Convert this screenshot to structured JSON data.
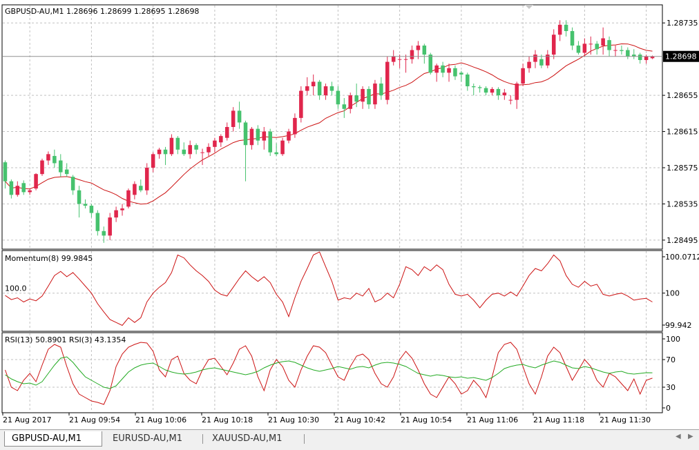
{
  "window": {
    "main_title": "GBPUSD-AU,M1  1.28696 1.28699 1.28695 1.28698",
    "current_price": "1.28698"
  },
  "panels": {
    "price": {
      "axis_labels": [
        "1.28735",
        "1.28655",
        "1.28615",
        "1.28575",
        "1.28535",
        "1.28495"
      ]
    },
    "momentum": {
      "title": "Momentum(8) 99.9845",
      "level_label": "100.0",
      "axis_labels": [
        "100.0712",
        "100",
        "99.942"
      ]
    },
    "rsi": {
      "title": "RSI(13) 50.8901  RSI(3) 43.1354",
      "axis_labels": [
        "100",
        "70",
        "30",
        "0"
      ]
    }
  },
  "time_axis": [
    "21 Aug 2017",
    "21 Aug 09:54",
    "21 Aug 10:06",
    "21 Aug 10:18",
    "21 Aug 10:30",
    "21 Aug 10:42",
    "21 Aug 10:54",
    "21 Aug 11:06",
    "21 Aug 11:18",
    "21 Aug 11:30"
  ],
  "colors": {
    "bull": "#e0264c",
    "bear": "#46c26e",
    "ma": "#cc1111",
    "momentum": "#cc1111",
    "rsi_fast": "#cc1111",
    "rsi_slow": "#22aa22",
    "grid": "#c0c0c0"
  },
  "tabs": [
    {
      "label": "GBPUSD-AU,M1",
      "active": true
    },
    {
      "label": "EURUSD-AU,M1",
      "active": false
    },
    {
      "label": "XAUUSD-AU,M1",
      "active": false
    }
  ],
  "chart_data": {
    "type": "candlestick",
    "symbol": "GBPUSD-AU,M1",
    "ylim": [
      1.28485,
      1.28755
    ],
    "ohlc": [
      [
        1.28581,
        1.28583,
        1.28552,
        1.2856
      ],
      [
        1.2856,
        1.28562,
        1.28541,
        1.28545
      ],
      [
        1.28545,
        1.2856,
        1.28543,
        1.28555
      ],
      [
        1.28558,
        1.28561,
        1.28545,
        1.28548
      ],
      [
        1.28548,
        1.28552,
        1.28545,
        1.2855
      ],
      [
        1.28552,
        1.28569,
        1.2855,
        1.28568
      ],
      [
        1.28568,
        1.28585,
        1.28566,
        1.28583
      ],
      [
        1.28583,
        1.28593,
        1.28578,
        1.2859
      ],
      [
        1.28588,
        1.28595,
        1.28575,
        1.2858
      ],
      [
        1.28583,
        1.2859,
        1.28565,
        1.2857
      ],
      [
        1.28573,
        1.2858,
        1.28565,
        1.28568
      ],
      [
        1.28565,
        1.28567,
        1.28545,
        1.2855
      ],
      [
        1.2855,
        1.28555,
        1.2852,
        1.28535
      ],
      [
        1.28535,
        1.2854,
        1.2853,
        1.28533
      ],
      [
        1.28533,
        1.28535,
        1.2852,
        1.28525
      ],
      [
        1.28525,
        1.28528,
        1.285,
        1.28505
      ],
      [
        1.28505,
        1.2851,
        1.28492,
        1.285
      ],
      [
        1.285,
        1.28525,
        1.28495,
        1.2852
      ],
      [
        1.2852,
        1.28532,
        1.28515,
        1.28528
      ],
      [
        1.28528,
        1.28535,
        1.28522,
        1.2853
      ],
      [
        1.28532,
        1.28552,
        1.2853,
        1.2855
      ],
      [
        1.28545,
        1.2856,
        1.2854,
        1.28557
      ],
      [
        1.28555,
        1.28562,
        1.28548,
        1.2855
      ],
      [
        1.2855,
        1.2858,
        1.28545,
        1.28575
      ],
      [
        1.28575,
        1.28592,
        1.2857,
        1.2859
      ],
      [
        1.2859,
        1.28597,
        1.28585,
        1.28595
      ],
      [
        1.28595,
        1.28598,
        1.28578,
        1.2859
      ],
      [
        1.2859,
        1.28612,
        1.28588,
        1.28608
      ],
      [
        1.28608,
        1.2861,
        1.2859,
        1.28595
      ],
      [
        1.28595,
        1.28603,
        1.28588,
        1.2859
      ],
      [
        1.2859,
        1.28605,
        1.28585,
        1.286
      ],
      [
        1.286,
        1.28602,
        1.2859,
        1.28595
      ],
      [
        1.28592,
        1.28596,
        1.28578,
        1.28592
      ],
      [
        1.28592,
        1.28602,
        1.28588,
        1.28598
      ],
      [
        1.28598,
        1.28608,
        1.28592,
        1.28605
      ],
      [
        1.28603,
        1.28612,
        1.28598,
        1.2861
      ],
      [
        1.28608,
        1.28625,
        1.28605,
        1.2862
      ],
      [
        1.2862,
        1.28642,
        1.28615,
        1.28638
      ],
      [
        1.28638,
        1.28648,
        1.28618,
        1.28625
      ],
      [
        1.28625,
        1.28627,
        1.2856,
        1.286
      ],
      [
        1.286,
        1.2862,
        1.28595,
        1.28618
      ],
      [
        1.28618,
        1.28622,
        1.286,
        1.28605
      ],
      [
        1.28605,
        1.2862,
        1.28595,
        1.28615
      ],
      [
        1.28615,
        1.28618,
        1.28588,
        1.28592
      ],
      [
        1.28592,
        1.28602,
        1.28588,
        1.2859
      ],
      [
        1.2859,
        1.28608,
        1.28588,
        1.28605
      ],
      [
        1.28605,
        1.28618,
        1.28602,
        1.28615
      ],
      [
        1.28612,
        1.28635,
        1.28608,
        1.2863
      ],
      [
        1.2863,
        1.28665,
        1.28625,
        1.2866
      ],
      [
        1.2866,
        1.28675,
        1.28655,
        1.28665
      ],
      [
        1.28665,
        1.28678,
        1.28655,
        1.2867
      ],
      [
        1.2867,
        1.28672,
        1.2865,
        1.28655
      ],
      [
        1.28655,
        1.28668,
        1.2865,
        1.28665
      ],
      [
        1.28665,
        1.2867,
        1.28655,
        1.2866
      ],
      [
        1.2866,
        1.28665,
        1.2864,
        1.28645
      ],
      [
        1.28645,
        1.28652,
        1.2863,
        1.2864
      ],
      [
        1.2864,
        1.28658,
        1.28635,
        1.28655
      ],
      [
        1.28655,
        1.28668,
        1.28642,
        1.28648
      ],
      [
        1.28648,
        1.28665,
        1.2864,
        1.28662
      ],
      [
        1.28662,
        1.28665,
        1.2864,
        1.28645
      ],
      [
        1.28645,
        1.28672,
        1.2864,
        1.28668
      ],
      [
        1.28668,
        1.28675,
        1.2865,
        1.28655
      ],
      [
        1.2865,
        1.28698,
        1.28645,
        1.28692
      ],
      [
        1.28692,
        1.28705,
        1.28688,
        1.28698
      ],
      [
        1.28695,
        1.287,
        1.28685,
        1.28695
      ],
      [
        1.28695,
        1.287,
        1.2868,
        1.28695
      ],
      [
        1.28695,
        1.2871,
        1.2869,
        1.28705
      ],
      [
        1.28705,
        1.28715,
        1.28695,
        1.2871
      ],
      [
        1.2871,
        1.28712,
        1.2869,
        1.287
      ],
      [
        1.287,
        1.28702,
        1.28678,
        1.2868
      ],
      [
        1.2868,
        1.2869,
        1.2867,
        1.28688
      ],
      [
        1.28688,
        1.28692,
        1.28675,
        1.2868
      ],
      [
        1.2868,
        1.2869,
        1.2867,
        1.28685
      ],
      [
        1.28685,
        1.28688,
        1.28672,
        1.28676
      ],
      [
        1.2868,
        1.28682,
        1.2867,
        1.28678
      ],
      [
        1.28678,
        1.2868,
        1.2866,
        1.28665
      ],
      [
        1.28665,
        1.28668,
        1.28655,
        1.28664
      ],
      [
        1.28664,
        1.28666,
        1.28658,
        1.28663
      ],
      [
        1.28663,
        1.28665,
        1.28655,
        1.28658
      ],
      [
        1.28658,
        1.28664,
        1.28655,
        1.28662
      ],
      [
        1.28662,
        1.28664,
        1.2865,
        1.28655
      ],
      [
        1.28655,
        1.28662,
        1.2865,
        1.28658
      ],
      [
        1.2865,
        1.28655,
        1.28645,
        1.2865
      ],
      [
        1.2865,
        1.2867,
        1.2864,
        1.28668
      ],
      [
        1.28668,
        1.2869,
        1.28665,
        1.28685
      ],
      [
        1.28685,
        1.28698,
        1.2868,
        1.28692
      ],
      [
        1.28692,
        1.28705,
        1.28685,
        1.287
      ],
      [
        1.28695,
        1.287,
        1.28685,
        1.28688
      ],
      [
        1.28688,
        1.28705,
        1.28685,
        1.287
      ],
      [
        1.287,
        1.28728,
        1.28695,
        1.28722
      ],
      [
        1.28722,
        1.28738,
        1.28715,
        1.28733
      ],
      [
        1.28733,
        1.28738,
        1.2872,
        1.28726
      ],
      [
        1.28726,
        1.2873,
        1.28705,
        1.2871
      ],
      [
        1.2871,
        1.28715,
        1.287,
        1.28702
      ],
      [
        1.28702,
        1.28718,
        1.28698,
        1.28712
      ],
      [
        1.28712,
        1.2872,
        1.287,
        1.28712
      ],
      [
        1.28712,
        1.28715,
        1.287,
        1.28706
      ],
      [
        1.2871,
        1.2873,
        1.287,
        1.28718
      ],
      [
        1.28716,
        1.2872,
        1.28698,
        1.28705
      ],
      [
        1.28705,
        1.2871,
        1.28698,
        1.28705
      ],
      [
        1.28705,
        1.2871,
        1.287,
        1.28704
      ],
      [
        1.28705,
        1.28708,
        1.28695,
        1.28698
      ],
      [
        1.287,
        1.28706,
        1.28695,
        1.28698
      ],
      [
        1.287,
        1.28702,
        1.2869,
        1.28694
      ],
      [
        1.28694,
        1.287,
        1.2869,
        1.28698
      ],
      [
        1.28696,
        1.28699,
        1.28695,
        1.28698
      ]
    ],
    "ma_period": 13,
    "momentum": {
      "ylim": [
        99.935,
        100.0725
      ],
      "level": 100.0,
      "values": [
        99.996,
        99.989,
        99.992,
        99.985,
        99.99,
        99.987,
        99.995,
        100.012,
        100.03,
        100.037,
        100.028,
        100.035,
        100.024,
        100.012,
        100.0,
        99.982,
        99.968,
        99.955,
        99.95,
        99.945,
        99.958,
        99.95,
        99.958,
        99.985,
        100.0,
        100.01,
        100.018,
        100.035,
        100.065,
        100.06,
        100.048,
        100.038,
        100.03,
        100.02,
        100.005,
        99.998,
        99.995,
        100.01,
        100.025,
        100.038,
        100.028,
        100.02,
        100.028,
        100.018,
        99.998,
        99.985,
        99.96,
        99.992,
        100.02,
        100.042,
        100.065,
        100.07,
        100.045,
        100.02,
        99.988,
        99.992,
        99.99,
        100.0,
        99.995,
        100.008,
        99.985,
        99.99,
        100.0,
        99.992,
        100.015,
        100.045,
        100.04,
        100.03,
        100.045,
        100.038,
        100.048,
        100.04,
        100.015,
        99.998,
        99.995,
        99.998,
        99.988,
        99.975,
        99.988,
        99.998,
        100.0,
        99.995,
        100.002,
        99.995,
        100.012,
        100.03,
        100.042,
        100.038,
        100.05,
        100.065,
        100.055,
        100.03,
        100.015,
        100.01,
        100.02,
        100.012,
        100.015,
        99.998,
        99.995,
        99.998,
        100.0,
        99.995,
        99.988,
        99.99,
        99.991,
        99.985
      ]
    },
    "rsi": {
      "ylim": [
        0,
        100
      ],
      "rsi13": [
        48,
        42,
        38,
        35,
        36,
        33,
        38,
        50,
        62,
        72,
        74,
        66,
        55,
        45,
        40,
        35,
        30,
        28,
        32,
        42,
        52,
        58,
        62,
        64,
        65,
        60,
        55,
        52,
        50,
        49,
        50,
        52,
        55,
        57,
        58,
        56,
        54,
        52,
        50,
        48,
        50,
        53,
        58,
        62,
        65,
        67,
        68,
        66,
        62,
        58,
        55,
        53,
        55,
        57,
        60,
        58,
        56,
        59,
        60,
        58,
        62,
        65,
        66,
        65,
        63,
        60,
        55,
        50,
        48,
        46,
        48,
        47,
        45,
        44,
        45,
        43,
        44,
        42,
        40,
        44,
        50,
        57,
        60,
        62,
        63,
        60,
        58,
        62,
        65,
        68,
        66,
        62,
        58,
        57,
        60,
        58,
        55,
        52,
        50,
        52,
        53,
        50,
        49,
        50,
        51,
        50.89
      ],
      "rsi3": [
        55,
        30,
        25,
        40,
        50,
        38,
        62,
        85,
        92,
        88,
        60,
        35,
        20,
        15,
        10,
        8,
        5,
        25,
        60,
        78,
        88,
        92,
        95,
        94,
        82,
        55,
        45,
        70,
        75,
        50,
        40,
        35,
        55,
        70,
        72,
        60,
        48,
        65,
        85,
        90,
        75,
        45,
        25,
        55,
        70,
        60,
        40,
        30,
        55,
        75,
        90,
        88,
        80,
        62,
        45,
        40,
        60,
        75,
        78,
        70,
        50,
        35,
        30,
        45,
        70,
        82,
        72,
        55,
        35,
        20,
        15,
        30,
        45,
        35,
        20,
        25,
        40,
        30,
        15,
        45,
        80,
        92,
        95,
        85,
        60,
        35,
        20,
        45,
        75,
        88,
        80,
        60,
        40,
        55,
        70,
        60,
        40,
        30,
        50,
        45,
        35,
        25,
        42,
        20,
        40,
        43.14
      ]
    }
  }
}
